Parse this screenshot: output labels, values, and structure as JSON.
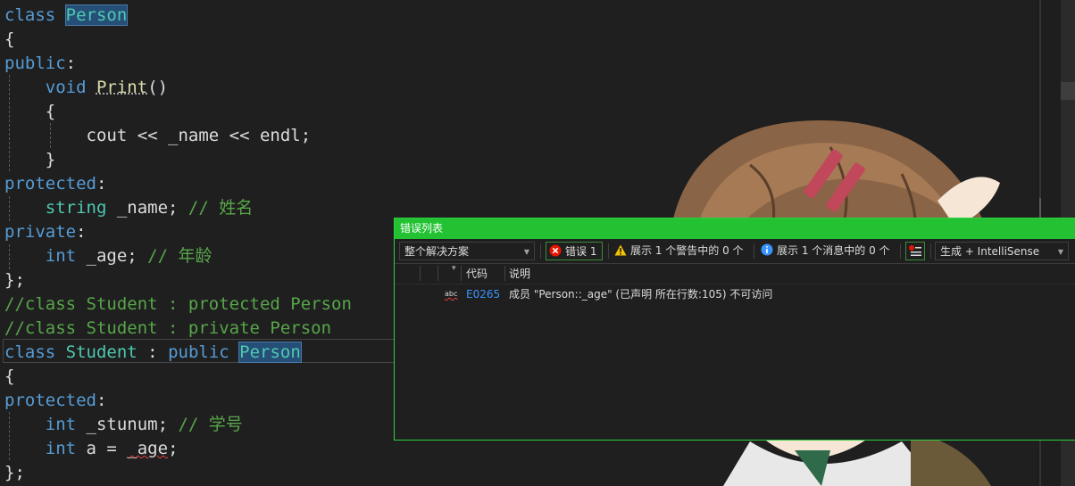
{
  "code_lines": [
    [
      [
        "kw",
        "class"
      ],
      [
        "pl",
        " "
      ],
      [
        "ty hl",
        "Person"
      ]
    ],
    [
      [
        "pl",
        "{"
      ]
    ],
    [
      [
        "kw",
        "public"
      ],
      [
        "pl",
        ":"
      ]
    ],
    [
      [
        "pl",
        "    "
      ],
      [
        "kw",
        "void"
      ],
      [
        "pl",
        " "
      ],
      [
        "fn dotted",
        "Print"
      ],
      [
        "pl",
        "()"
      ]
    ],
    [
      [
        "pl",
        "    {"
      ]
    ],
    [
      [
        "pl",
        "        cout << _name << endl;"
      ]
    ],
    [
      [
        "pl",
        "    }"
      ]
    ],
    [
      [
        "kw",
        "protected"
      ],
      [
        "pl",
        ":"
      ]
    ],
    [
      [
        "pl",
        "    "
      ],
      [
        "ty",
        "string"
      ],
      [
        "pl",
        " _name; "
      ],
      [
        "cm",
        "// 姓名"
      ]
    ],
    [
      [
        "kw",
        "private"
      ],
      [
        "pl",
        ":"
      ]
    ],
    [
      [
        "pl",
        "    "
      ],
      [
        "kw",
        "int"
      ],
      [
        "pl",
        " _age; "
      ],
      [
        "cm",
        "// 年龄"
      ]
    ],
    [
      [
        "pl",
        "};"
      ]
    ],
    [
      [
        "cm",
        "//class Student : protected Person"
      ]
    ],
    [
      [
        "cm",
        "//class Student : private Person"
      ]
    ],
    [
      [
        "kw",
        "class"
      ],
      [
        "pl",
        " "
      ],
      [
        "ty",
        "Student"
      ],
      [
        "pl",
        " : "
      ],
      [
        "kw",
        "public"
      ],
      [
        "pl",
        " "
      ],
      [
        "ty hl",
        "Person"
      ]
    ],
    [
      [
        "pl",
        "{"
      ]
    ],
    [
      [
        "kw",
        "protected"
      ],
      [
        "pl",
        ":"
      ]
    ],
    [
      [
        "pl",
        "    "
      ],
      [
        "kw",
        "int"
      ],
      [
        "pl",
        " _stunum; "
      ],
      [
        "cm",
        "// 学号"
      ]
    ],
    [
      [
        "pl",
        "    "
      ],
      [
        "kw",
        "int"
      ],
      [
        "pl",
        " a = "
      ],
      [
        "pl squig",
        "_age"
      ],
      [
        "pl",
        ";"
      ]
    ],
    [
      [
        "pl",
        "};"
      ]
    ]
  ],
  "error_list": {
    "title": "错误列表",
    "scope_dropdown": "整个解决方案",
    "errors_button": "错误 1",
    "warnings_button": "展示 1 个警告中的 0 个",
    "messages_button": "展示 1 个消息中的 0 个",
    "build_dropdown": "生成 + IntelliSense",
    "columns": {
      "code": "代码",
      "description": "说明"
    },
    "rows": [
      {
        "code": "E0265",
        "description": "成员 \"Person::_age\" (已声明 所在行数:105) 不可访问"
      }
    ]
  },
  "colors": {
    "keyword": "#569cd6",
    "type": "#4ec9b0",
    "function": "#dcdcaa",
    "comment": "#57a64a",
    "panel_accent": "#22c232",
    "error_code": "#3794ff"
  }
}
